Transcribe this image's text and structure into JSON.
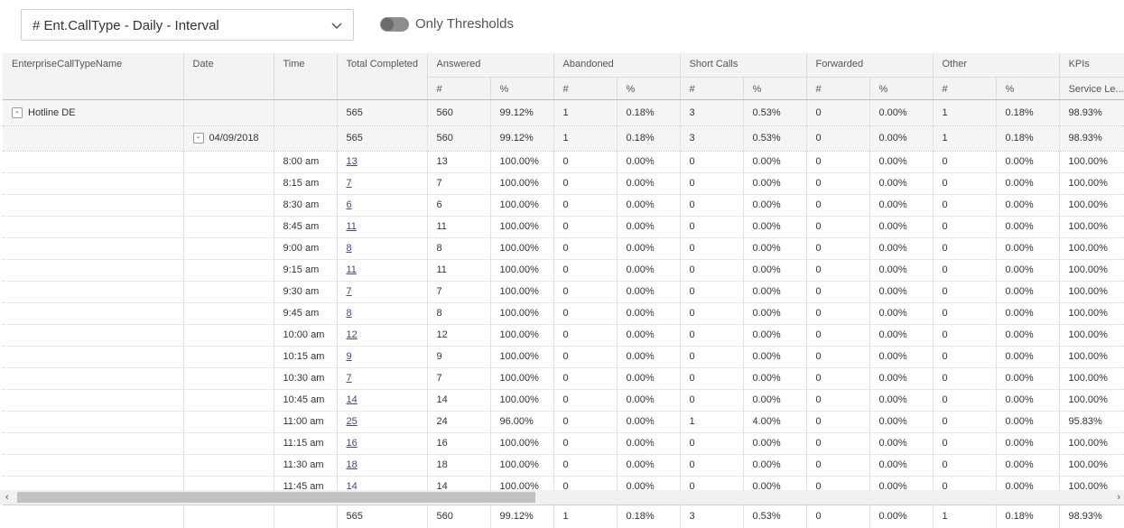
{
  "toolbar": {
    "report_select": "# Ent.CallType - Daily - Interval",
    "toggle_label": "Only Thresholds"
  },
  "columns": {
    "name": "EnterpriseCallTypeName",
    "date": "Date",
    "time": "Time",
    "total": "Total Completed",
    "answered": "Answered",
    "abandoned": "Abandoned",
    "short_calls": "Short Calls",
    "forwarded": "Forwarded",
    "other": "Other",
    "kpis": "KPIs",
    "count": "#",
    "pct": "%",
    "service_level": "Service Le..."
  },
  "group": {
    "expander": "-",
    "name": "Hotline DE",
    "total": "565",
    "ans_n": "560",
    "ans_p": "99.12%",
    "ab_n": "1",
    "ab_p": "0.18%",
    "sc_n": "3",
    "sc_p": "0.53%",
    "fw_n": "0",
    "fw_p": "0.00%",
    "ot_n": "1",
    "ot_p": "0.18%",
    "sl": "98.93%"
  },
  "subgroup": {
    "expander": "-",
    "date": "04/09/2018",
    "total": "565",
    "ans_n": "560",
    "ans_p": "99.12%",
    "ab_n": "1",
    "ab_p": "0.18%",
    "sc_n": "3",
    "sc_p": "0.53%",
    "fw_n": "0",
    "fw_p": "0.00%",
    "ot_n": "1",
    "ot_p": "0.18%",
    "sl": "98.93%"
  },
  "rows": [
    [
      "8:00 am",
      "13",
      "13",
      "100.00%",
      "0",
      "0.00%",
      "0",
      "0.00%",
      "0",
      "0.00%",
      "0",
      "0.00%",
      "100.00%"
    ],
    [
      "8:15 am",
      "7",
      "7",
      "100.00%",
      "0",
      "0.00%",
      "0",
      "0.00%",
      "0",
      "0.00%",
      "0",
      "0.00%",
      "100.00%"
    ],
    [
      "8:30 am",
      "6",
      "6",
      "100.00%",
      "0",
      "0.00%",
      "0",
      "0.00%",
      "0",
      "0.00%",
      "0",
      "0.00%",
      "100.00%"
    ],
    [
      "8:45 am",
      "11",
      "11",
      "100.00%",
      "0",
      "0.00%",
      "0",
      "0.00%",
      "0",
      "0.00%",
      "0",
      "0.00%",
      "100.00%"
    ],
    [
      "9:00 am",
      "8",
      "8",
      "100.00%",
      "0",
      "0.00%",
      "0",
      "0.00%",
      "0",
      "0.00%",
      "0",
      "0.00%",
      "100.00%"
    ],
    [
      "9:15 am",
      "11",
      "11",
      "100.00%",
      "0",
      "0.00%",
      "0",
      "0.00%",
      "0",
      "0.00%",
      "0",
      "0.00%",
      "100.00%"
    ],
    [
      "9:30 am",
      "7",
      "7",
      "100.00%",
      "0",
      "0.00%",
      "0",
      "0.00%",
      "0",
      "0.00%",
      "0",
      "0.00%",
      "100.00%"
    ],
    [
      "9:45 am",
      "8",
      "8",
      "100.00%",
      "0",
      "0.00%",
      "0",
      "0.00%",
      "0",
      "0.00%",
      "0",
      "0.00%",
      "100.00%"
    ],
    [
      "10:00 am",
      "12",
      "12",
      "100.00%",
      "0",
      "0.00%",
      "0",
      "0.00%",
      "0",
      "0.00%",
      "0",
      "0.00%",
      "100.00%"
    ],
    [
      "10:15 am",
      "9",
      "9",
      "100.00%",
      "0",
      "0.00%",
      "0",
      "0.00%",
      "0",
      "0.00%",
      "0",
      "0.00%",
      "100.00%"
    ],
    [
      "10:30 am",
      "7",
      "7",
      "100.00%",
      "0",
      "0.00%",
      "0",
      "0.00%",
      "0",
      "0.00%",
      "0",
      "0.00%",
      "100.00%"
    ],
    [
      "10:45 am",
      "14",
      "14",
      "100.00%",
      "0",
      "0.00%",
      "0",
      "0.00%",
      "0",
      "0.00%",
      "0",
      "0.00%",
      "100.00%"
    ],
    [
      "11:00 am",
      "25",
      "24",
      "96.00%",
      "0",
      "0.00%",
      "1",
      "4.00%",
      "0",
      "0.00%",
      "0",
      "0.00%",
      "95.83%"
    ],
    [
      "11:15 am",
      "16",
      "16",
      "100.00%",
      "0",
      "0.00%",
      "0",
      "0.00%",
      "0",
      "0.00%",
      "0",
      "0.00%",
      "100.00%"
    ],
    [
      "11:30 am",
      "18",
      "18",
      "100.00%",
      "0",
      "0.00%",
      "0",
      "0.00%",
      "0",
      "0.00%",
      "0",
      "0.00%",
      "100.00%"
    ],
    [
      "11:45 am",
      "14",
      "14",
      "100.00%",
      "0",
      "0.00%",
      "0",
      "0.00%",
      "0",
      "0.00%",
      "0",
      "0.00%",
      "100.00%"
    ]
  ],
  "footer": {
    "total": "565",
    "ans_n": "560",
    "ans_p": "99.12%",
    "ab_n": "1",
    "ab_p": "0.18%",
    "sc_n": "3",
    "sc_p": "0.53%",
    "fw_n": "0",
    "fw_p": "0.00%",
    "ot_n": "1",
    "ot_p": "0.18%",
    "sl": "98.93%"
  },
  "scrollbar": {
    "left_arrow": "‹",
    "right_arrow": "›"
  },
  "colors": {
    "link": "#3b4a8f",
    "header_bg": "#f3f3f3",
    "group_bg": "#f5f5f5"
  },
  "icons": {
    "dropdown": "chevron-down-icon",
    "expand": "collapse-toggle-icon"
  }
}
